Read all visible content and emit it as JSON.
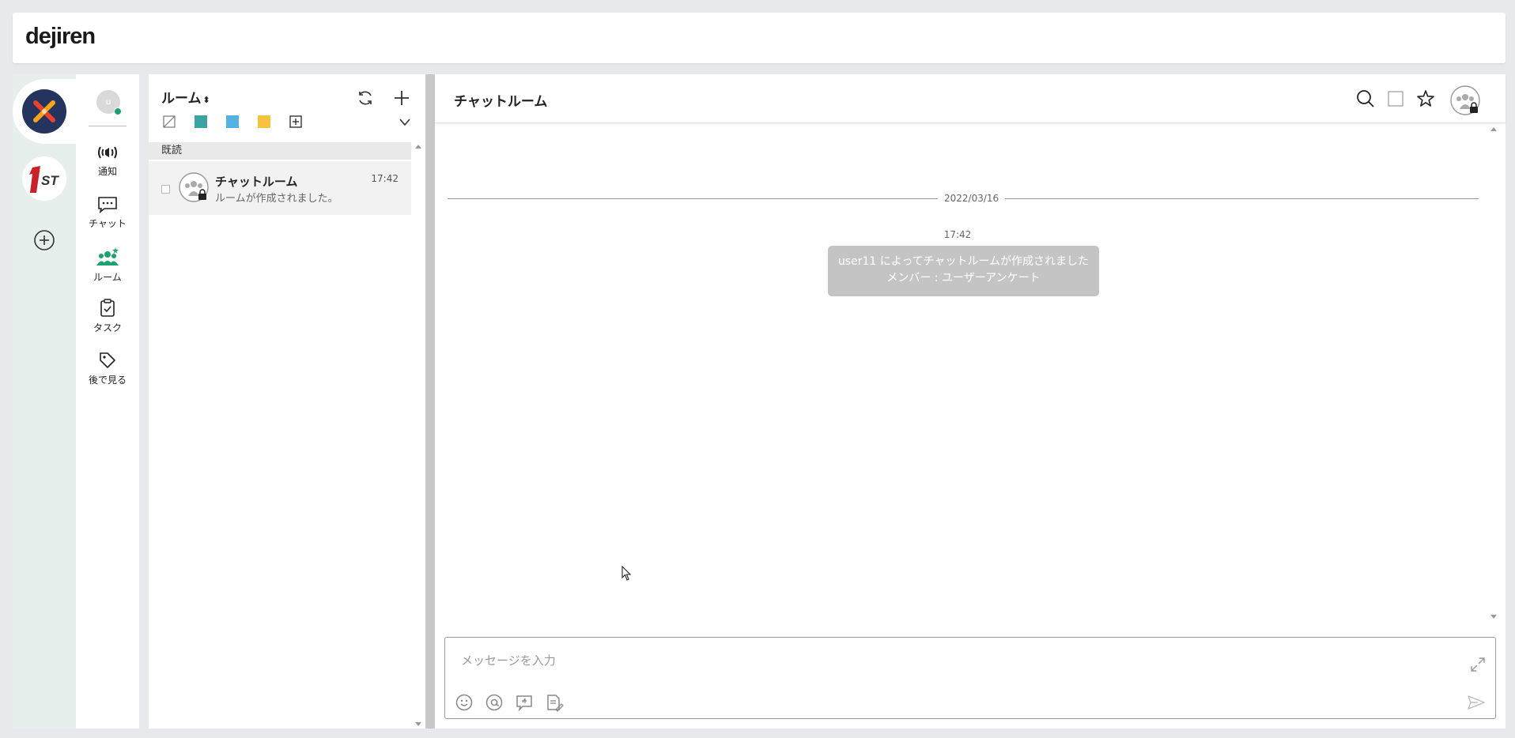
{
  "app": {
    "logo": "dejiren"
  },
  "workspaces": [
    {
      "name": "x-workspace",
      "icon": "x-logo-icon"
    },
    {
      "name": "1st-workspace",
      "icon": "1st-logo-icon"
    }
  ],
  "nav": {
    "avatar_initial": "u",
    "items": [
      {
        "label": "通知",
        "icon": "broadcast-icon"
      },
      {
        "label": "チャット",
        "icon": "chat-icon"
      },
      {
        "label": "ルーム",
        "icon": "room-group-icon",
        "active": true
      },
      {
        "label": "タスク",
        "icon": "clipboard-icon"
      },
      {
        "label": "後で見る",
        "icon": "tag-icon"
      }
    ]
  },
  "room_list": {
    "title": "ルーム",
    "sort_glyph": "⬍",
    "filter_colors": [
      "#3aa3a3",
      "#55b2e0",
      "#f6c240"
    ],
    "section_label": "既読",
    "rooms": [
      {
        "name": "チャットルーム",
        "time": "17:42",
        "last_message": "ルームが作成されました。"
      }
    ]
  },
  "chat": {
    "title": "チャットルーム",
    "date_divider": "2022/03/16",
    "system_message": {
      "time": "17:42",
      "line1": "user11 によってチャットルームが作成されました",
      "line2": "メンバー : ユーザーアンケート"
    },
    "input_placeholder": "メッセージを入力"
  },
  "colors": {
    "accent": "#1aa36f",
    "workspace_x_bg": "#24345f",
    "system_bubble": "#c4c4c4"
  }
}
